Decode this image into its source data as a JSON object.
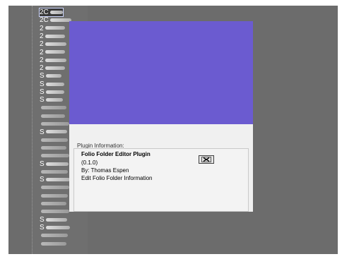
{
  "list": {
    "items": [
      {
        "label": "2C",
        "selected": true
      },
      {
        "label": "2C"
      },
      {
        "label": "2"
      },
      {
        "label": "2"
      },
      {
        "label": "2"
      },
      {
        "label": "2"
      },
      {
        "label": "2"
      },
      {
        "label": "2"
      },
      {
        "label": "S"
      },
      {
        "label": "S"
      },
      {
        "label": "S"
      },
      {
        "label": "S"
      },
      {
        "label": ""
      },
      {
        "label": ""
      },
      {
        "label": ""
      },
      {
        "label": "S"
      },
      {
        "label": ""
      },
      {
        "label": ""
      },
      {
        "label": ""
      },
      {
        "label": "S"
      },
      {
        "label": ""
      },
      {
        "label": "S"
      },
      {
        "label": ""
      },
      {
        "label": ""
      },
      {
        "label": ""
      },
      {
        "label": ""
      },
      {
        "label": "S"
      },
      {
        "label": "S"
      },
      {
        "label": ""
      },
      {
        "label": ""
      }
    ]
  },
  "dialog": {
    "group_title": "Plugin Information:",
    "plugin_name": "Folio Folder Editor Plugin",
    "plugin_version": "(0.1.0)",
    "plugin_author": "By: Thomas Espen",
    "plugin_description": "Edit Folio Folder Information",
    "banner_color": "#6b5bd0",
    "close_icon": "close-icon"
  }
}
